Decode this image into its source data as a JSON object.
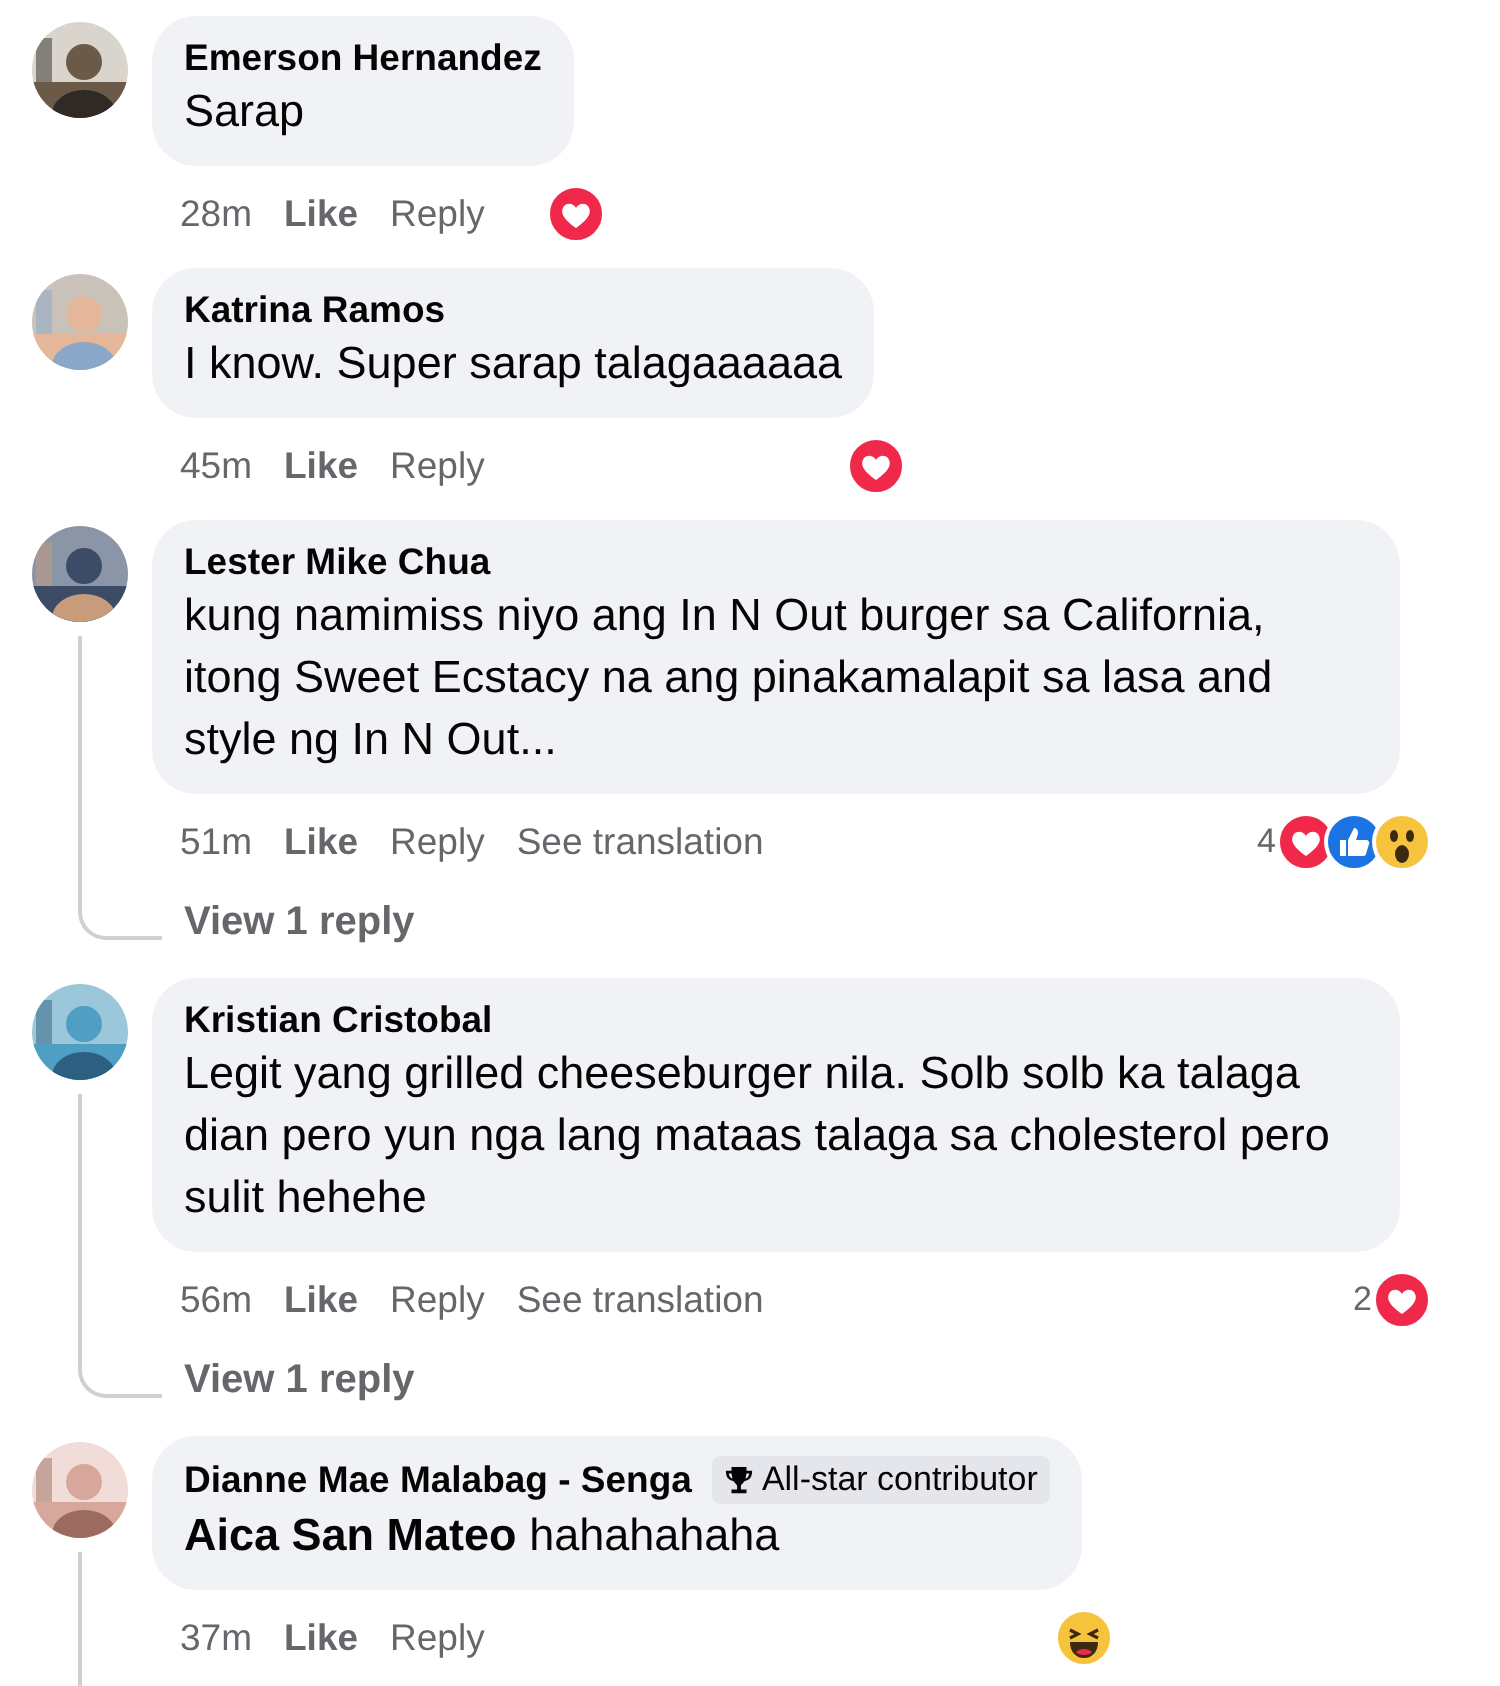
{
  "comments": [
    {
      "author": "Emerson Hernandez",
      "text": "Sarap",
      "time": "28m",
      "like": "Like",
      "reply": "Reply",
      "reactions": [
        {
          "kind": "heart"
        }
      ],
      "thread": false
    },
    {
      "author": "Katrina Ramos",
      "text": "I know. Super sarap talagaaaaaa",
      "time": "45m",
      "like": "Like",
      "reply": "Reply",
      "reactions": [
        {
          "kind": "heart"
        }
      ],
      "thread": false
    },
    {
      "author": "Lester Mike Chua",
      "text": "kung namimiss niyo ang In N Out burger sa California, itong Sweet Ecstacy na ang pinakamalapit sa lasa and style ng In N Out...",
      "time": "51m",
      "like": "Like",
      "reply": "Reply",
      "translate": "See translation",
      "reaction_count": "4",
      "reactions": [
        {
          "kind": "heart"
        },
        {
          "kind": "like"
        },
        {
          "kind": "wow"
        }
      ],
      "thread": true,
      "replies_link": "View 1 reply"
    },
    {
      "author": "Kristian Cristobal",
      "text": "Legit yang grilled cheeseburger nila. Solb solb ka talaga dian pero yun nga lang mataas talaga sa cholesterol pero sulit hehehe",
      "time": "56m",
      "like": "Like",
      "reply": "Reply",
      "translate": "See translation",
      "reaction_count": "2",
      "reactions": [
        {
          "kind": "heart"
        }
      ],
      "thread": true,
      "replies_link": "View 1 reply"
    },
    {
      "author": "Dianne Mae Malabag - Senga",
      "badge": "All-star contributor",
      "text": "**Aica San Mateo** hahahahaha",
      "time": "37m",
      "like": "Like",
      "reply": "Reply",
      "reactions": [
        {
          "kind": "haha"
        }
      ],
      "thread": true
    }
  ]
}
